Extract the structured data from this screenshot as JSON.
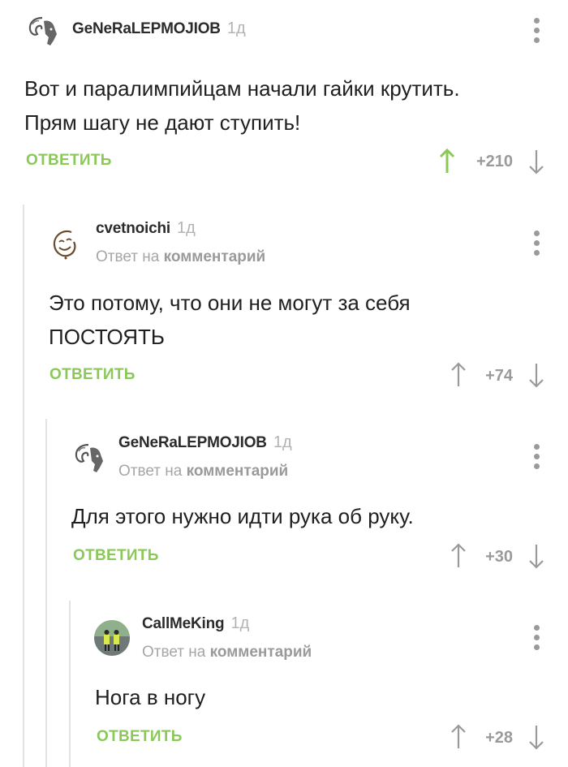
{
  "comments": [
    {
      "username": "GeNeRaLEPMOJIOB",
      "time": "1д",
      "text_lines": [
        "Вот и паралимпийцам начали гайки крутить.",
        "Прям шагу не дают ступить!"
      ],
      "reply_label": "ОТВЕТИТЬ",
      "rating": "+210",
      "voted_up": true,
      "avatar": "ram-icon"
    },
    {
      "username": "cvetnoichi",
      "time": "1д",
      "reply_to_prefix": "Ответ на",
      "reply_to_target": "комментарий",
      "text_lines": [
        "Это потому, что они не могут за себя",
        "ПОСТОЯТЬ"
      ],
      "reply_label": "ОТВЕТИТЬ",
      "rating": "+74",
      "voted_up": false,
      "avatar": "smiley-icon"
    },
    {
      "username": "GeNeRaLEPMOJIOB",
      "time": "1д",
      "reply_to_prefix": "Ответ на",
      "reply_to_target": "комментарий",
      "text_lines": [
        "Для этого нужно идти рука об руку."
      ],
      "reply_label": "ОТВЕТИТЬ",
      "rating": "+30",
      "voted_up": false,
      "avatar": "ram-icon"
    },
    {
      "username": "CallMeKing",
      "time": "1д",
      "reply_to_prefix": "Ответ на",
      "reply_to_target": "комментарий",
      "text_lines": [
        "Нога в ногу"
      ],
      "reply_label": "ОТВЕТИТЬ",
      "rating": "+28",
      "voted_up": false,
      "avatar": "photo-avatar-icon"
    }
  ],
  "colors": {
    "accent_green": "#8ac858",
    "muted_gray": "#9a9a9a",
    "thread_line": "#e3e3e3"
  }
}
